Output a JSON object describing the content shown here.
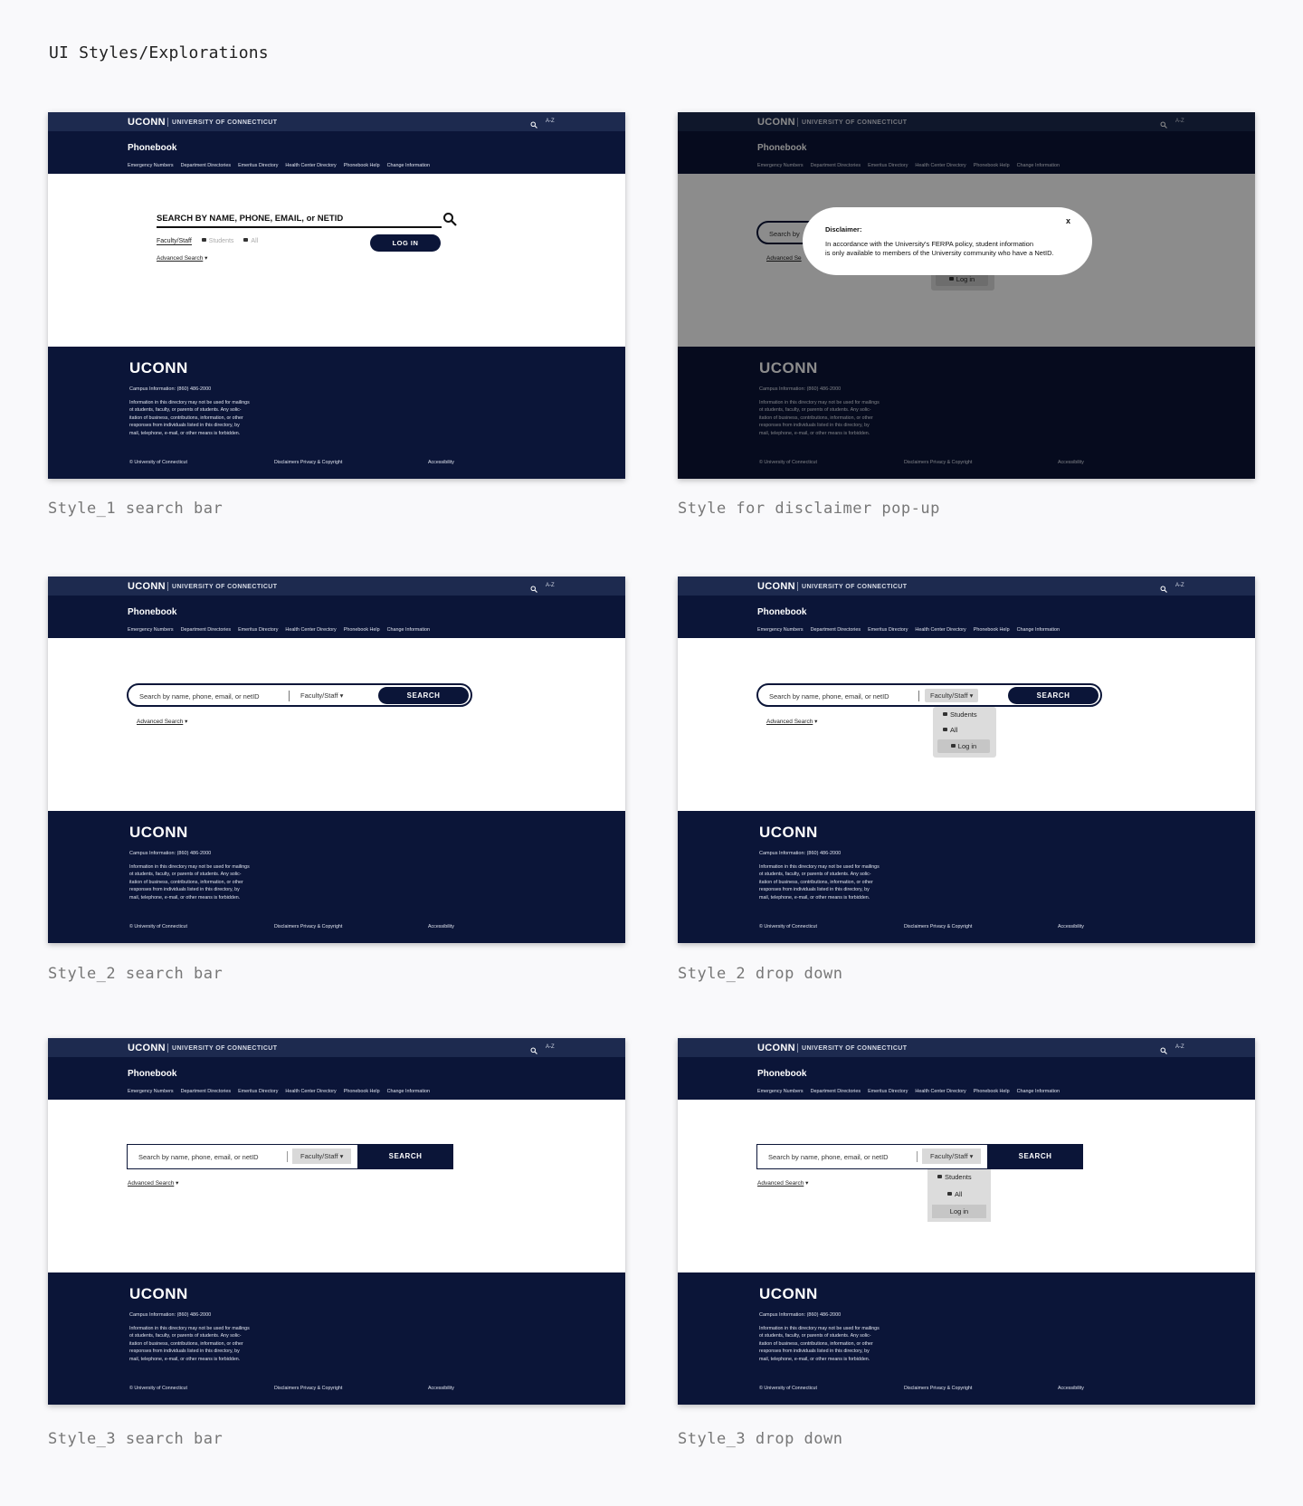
{
  "page_title": "UI Styles/Explorations",
  "common": {
    "logo": "UCONN",
    "university": "UNIVERSITY OF CONNECTICUT",
    "az": "A-Z",
    "app_title": "Phonebook",
    "nav": [
      "Emergency Numbers",
      "Department Directories",
      "Emeritus Directory",
      "Health Center Directory",
      "Phonebook Help",
      "Change Information"
    ],
    "footer_logo": "UCONN",
    "campus": "Campus Information: (860) 486-2000",
    "info_lines": [
      "Information in this directory may not be used for mailings",
      "ot students, faculty, or parents of students. Any solic-",
      "itation of business, contributions, information, or other",
      "responses from individuals listed in this directory, by",
      "mail, telephone, e-mail, or other means is forbidden."
    ],
    "copyright": "© University of Connecticut",
    "disclaimers": "Disclaimers Privacy & Copyright",
    "accessibility": "Accessibility",
    "advanced": "Advanced Search",
    "placeholder": "Search by name, phone, email, or netID",
    "faculty": "Faculty/Staff",
    "search_btn": "SEARCH",
    "students": "Students",
    "all": "All",
    "login": "Log in"
  },
  "style1": {
    "caption": "Style_1 search bar",
    "search_label": "SEARCH BY NAME, PHONE, EMAIL, or NETID",
    "tab_faculty": "Faculty/Staff",
    "tab_students": "Students",
    "tab_all": "All",
    "login_btn": "LOG IN"
  },
  "disclaimer": {
    "caption": "Style for disclaimer pop-up",
    "title": "Disclaimer:",
    "text_1": "In accordance with the University's FERPA policy, student information",
    "text_2": "is only available to members of the University community who have a NetID.",
    "close": "x",
    "search_partial": "Search by",
    "adv_partial": "Advanced Se"
  },
  "style2": {
    "caption": "Style_2 search bar"
  },
  "style2dd": {
    "caption": "Style_2 drop down"
  },
  "style3": {
    "caption": "Style_3 search bar"
  },
  "style3dd": {
    "caption": "Style_3 drop down"
  },
  "colors": {
    "navy": "#0b1538",
    "topbar": "#1d2a4f",
    "background": "#f9f9fb"
  }
}
